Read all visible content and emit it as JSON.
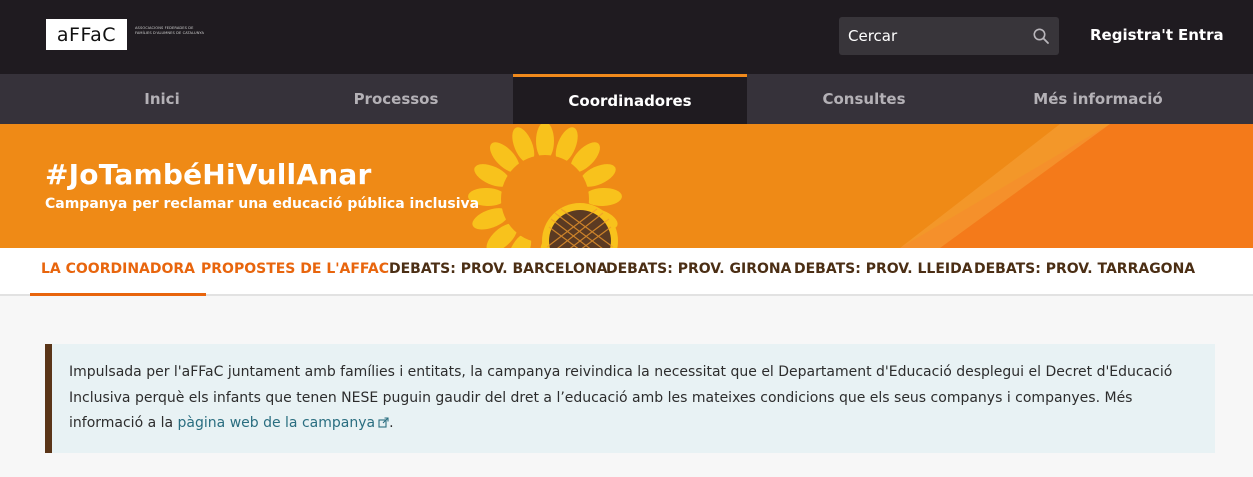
{
  "header": {
    "logo_text": "aFFaC",
    "logo_subtitle": "ASSOCIACIONS FEDERADES DE FAMÍLIES D'ALUMNES DE CATALUNYA",
    "search_placeholder": "Cercar",
    "search_icon": "magnifier-icon",
    "register_label": "Registra't",
    "login_label": "Entra"
  },
  "main_nav": {
    "items": [
      {
        "label": "Inici",
        "active": false
      },
      {
        "label": "Processos",
        "active": false
      },
      {
        "label": "Coordinadores",
        "active": true
      },
      {
        "label": "Consultes",
        "active": false
      },
      {
        "label": "Més informació",
        "active": false
      }
    ]
  },
  "banner": {
    "title": "#JoTambéHiVullAnar",
    "subtitle": "Campanya per reclamar una educació pública inclusiva",
    "image_icon": "sunflower-icon"
  },
  "sub_nav": {
    "items": [
      {
        "label": "LA COORDINADORA",
        "active": true
      },
      {
        "label": "PROPOSTES DE L'AFFAC",
        "active": false
      },
      {
        "label": "DEBATS: PROV. BARCELONA",
        "active": false
      },
      {
        "label": "DEBATS: PROV. GIRONA",
        "active": false
      },
      {
        "label": "DEBATS: PROV. LLEIDA",
        "active": false
      },
      {
        "label": "DEBATS: PROV. TARRAGONA",
        "active": false
      }
    ]
  },
  "callout": {
    "text_before_link": "Impulsada per l'aFFaC juntament amb famílies i entitats, la campanya reivindica la necessitat que el Departament d'Educació desplegui el Decret d'Educació Inclusiva perquè els infants que tenen NESE puguin gaudir del dret a l’educació amb les mateixes condicions que els seus companys i companyes. Més informació a la ",
    "link_text": "pàgina web de la campanya",
    "link_icon": "external-link-icon",
    "text_after_link": "."
  },
  "colors": {
    "header_bg": "#1f1b20",
    "nav_bg": "#36323a",
    "accent_orange": "#ef8a16",
    "subnav_orange": "#e8650d",
    "subnav_brown": "#4b2e14",
    "callout_border": "#5a3518",
    "callout_bg": "#e8f2f4",
    "link": "#2a6e80"
  }
}
